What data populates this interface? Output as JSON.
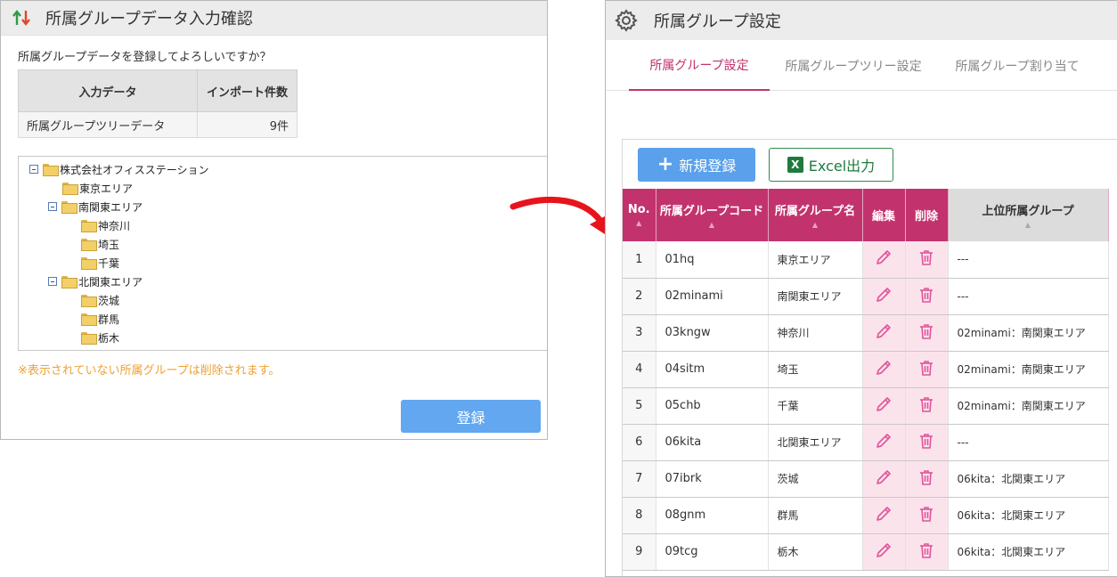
{
  "dialog": {
    "title": "所属グループデータ入力確認",
    "message": "所属グループデータを登録してよろしいですか？",
    "summary": {
      "col_input": "入力データ",
      "col_count": "インポート件数",
      "row_input": "所属グループツリーデータ",
      "row_count": "9件"
    },
    "tree": [
      {
        "label": "株式会社オフィスステーション",
        "level": 0,
        "expandable": true
      },
      {
        "label": "東京エリア",
        "level": 1,
        "expandable": false
      },
      {
        "label": "南関東エリア",
        "level": 1,
        "expandable": true
      },
      {
        "label": "神奈川",
        "level": 2,
        "expandable": false
      },
      {
        "label": "埼玉",
        "level": 2,
        "expandable": false
      },
      {
        "label": "千葉",
        "level": 2,
        "expandable": false
      },
      {
        "label": "北関東エリア",
        "level": 1,
        "expandable": true
      },
      {
        "label": "茨城",
        "level": 2,
        "expandable": false
      },
      {
        "label": "群馬",
        "level": 2,
        "expandable": false
      },
      {
        "label": "栃木",
        "level": 2,
        "expandable": false
      }
    ],
    "note": "※表示されていない所属グループは削除されます。",
    "register_label": "登録"
  },
  "panel": {
    "title": "所属グループ設定",
    "tabs": [
      {
        "label": "所属グループ設定",
        "active": true
      },
      {
        "label": "所属グループツリー設定",
        "active": false
      },
      {
        "label": "所属グループ割り当て",
        "active": false
      }
    ],
    "new_button": "新規登録",
    "excel_button": "Excel出力",
    "columns": {
      "no": "No.",
      "code": "所属グループコード",
      "name": "所属グループ名",
      "edit": "編集",
      "delete": "削除",
      "parent": "上位所属グループ"
    },
    "rows": [
      {
        "no": "1",
        "code": "01hq",
        "name": "東京エリア",
        "parent": "---"
      },
      {
        "no": "2",
        "code": "02minami",
        "name": "南関東エリア",
        "parent": "---"
      },
      {
        "no": "3",
        "code": "03kngw",
        "name": "神奈川",
        "parent": "02minami：南関東エリア"
      },
      {
        "no": "4",
        "code": "04sitm",
        "name": "埼玉",
        "parent": "02minami：南関東エリア"
      },
      {
        "no": "5",
        "code": "05chb",
        "name": "千葉",
        "parent": "02minami：南関東エリア"
      },
      {
        "no": "6",
        "code": "06kita",
        "name": "北関東エリア",
        "parent": "---"
      },
      {
        "no": "7",
        "code": "07ibrk",
        "name": "茨城",
        "parent": "06kita：北関東エリア"
      },
      {
        "no": "8",
        "code": "08gnm",
        "name": "群馬",
        "parent": "06kita：北関東エリア"
      },
      {
        "no": "9",
        "code": "09tcg",
        "name": "栃木",
        "parent": "06kita：北関東エリア"
      }
    ]
  },
  "colors": {
    "accent": "#c2336d",
    "primary_button": "#62a7f0",
    "excel_green": "#1f7a3e",
    "note_orange": "#f0a030",
    "arrow_red": "#e8141c"
  }
}
